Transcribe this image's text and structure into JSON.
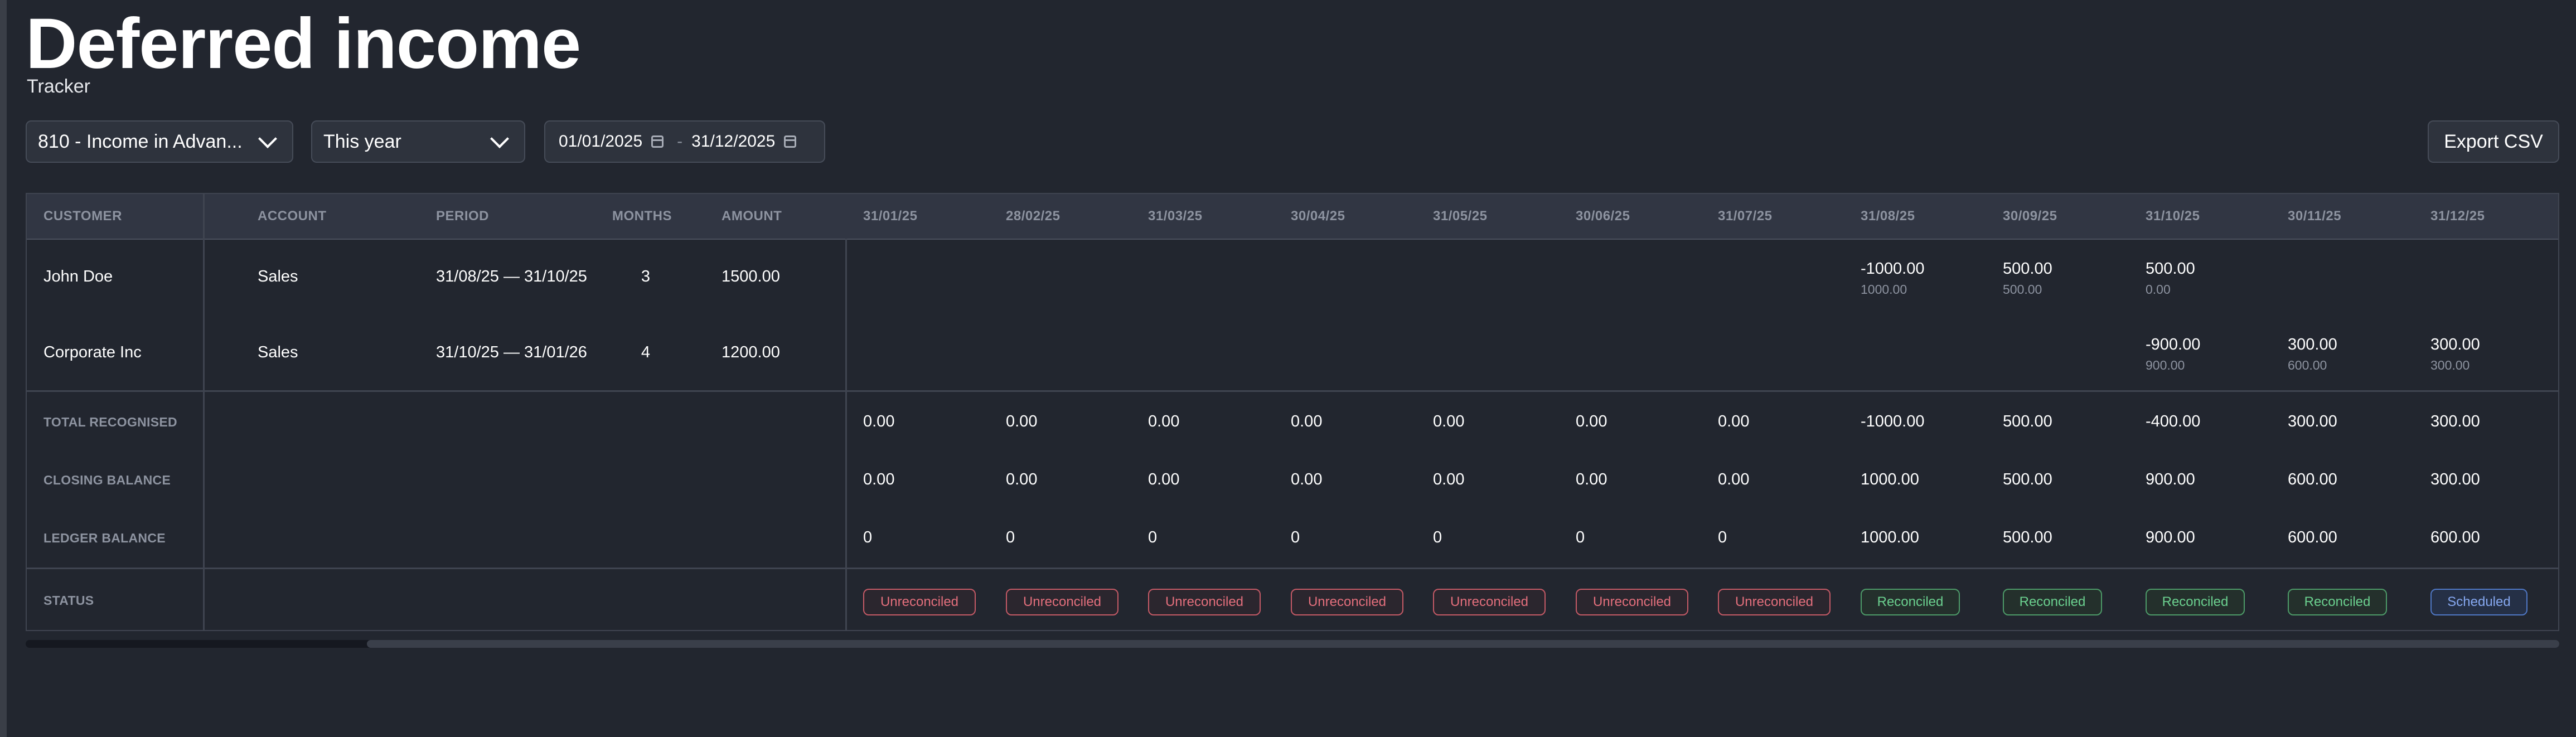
{
  "header": {
    "title": "Deferred income",
    "subtitle": "Tracker"
  },
  "controls": {
    "account_select": "810 - Income in Advan...",
    "period_select": "This year",
    "date_from": "01/01/2025",
    "date_sep": "-",
    "date_to": "31/12/2025",
    "export_label": "Export CSV"
  },
  "table": {
    "columns": [
      "CUSTOMER",
      "ACCOUNT",
      "PERIOD",
      "MONTHS",
      "AMOUNT"
    ],
    "months": [
      "31/01/25",
      "28/02/25",
      "31/03/25",
      "30/04/25",
      "31/05/25",
      "30/06/25",
      "31/07/25",
      "31/08/25",
      "30/09/25",
      "31/10/25",
      "30/11/25",
      "31/12/25"
    ],
    "rows": [
      {
        "customer": "John Doe",
        "account": "Sales",
        "period": "31/08/25 — 31/10/25",
        "months": "3",
        "amount": "1500.00",
        "schedule": [
          null,
          null,
          null,
          null,
          null,
          null,
          null,
          {
            "value": "-1000.00",
            "balance": "1000.00"
          },
          {
            "value": "500.00",
            "balance": "500.00"
          },
          {
            "value": "500.00",
            "balance": "0.00"
          },
          null,
          null
        ]
      },
      {
        "customer": "Corporate Inc",
        "account": "Sales",
        "period": "31/10/25 — 31/01/26",
        "months": "4",
        "amount": "1200.00",
        "schedule": [
          null,
          null,
          null,
          null,
          null,
          null,
          null,
          null,
          null,
          {
            "value": "-900.00",
            "balance": "900.00"
          },
          {
            "value": "300.00",
            "balance": "600.00"
          },
          {
            "value": "300.00",
            "balance": "300.00"
          }
        ]
      }
    ],
    "summary": [
      {
        "label": "TOTAL RECOGNISED",
        "values": [
          "0.00",
          "0.00",
          "0.00",
          "0.00",
          "0.00",
          "0.00",
          "0.00",
          "-1000.00",
          "500.00",
          "-400.00",
          "300.00",
          "300.00"
        ]
      },
      {
        "label": "CLOSING BALANCE",
        "values": [
          "0.00",
          "0.00",
          "0.00",
          "0.00",
          "0.00",
          "0.00",
          "0.00",
          "1000.00",
          "500.00",
          "900.00",
          "600.00",
          "300.00"
        ]
      },
      {
        "label": "LEDGER BALANCE",
        "values": [
          "0",
          "0",
          "0",
          "0",
          "0",
          "0",
          "0",
          "1000.00",
          "500.00",
          "900.00",
          "600.00",
          "600.00"
        ]
      }
    ],
    "status": {
      "label": "STATUS",
      "values": [
        "Unreconciled",
        "Unreconciled",
        "Unreconciled",
        "Unreconciled",
        "Unreconciled",
        "Unreconciled",
        "Unreconciled",
        "Reconciled",
        "Reconciled",
        "Reconciled",
        "Reconciled",
        "Scheduled"
      ],
      "kinds": [
        "unrec",
        "unrec",
        "unrec",
        "unrec",
        "unrec",
        "unrec",
        "unrec",
        "rec",
        "rec",
        "rec",
        "rec",
        "sched"
      ]
    }
  },
  "colors": {
    "background": "#22262f",
    "unreconciled": "#e36f7c",
    "reconciled": "#6bd08f",
    "scheduled": "#86a8f0"
  },
  "icons": [
    "chevron-down-icon",
    "calendar-icon"
  ]
}
